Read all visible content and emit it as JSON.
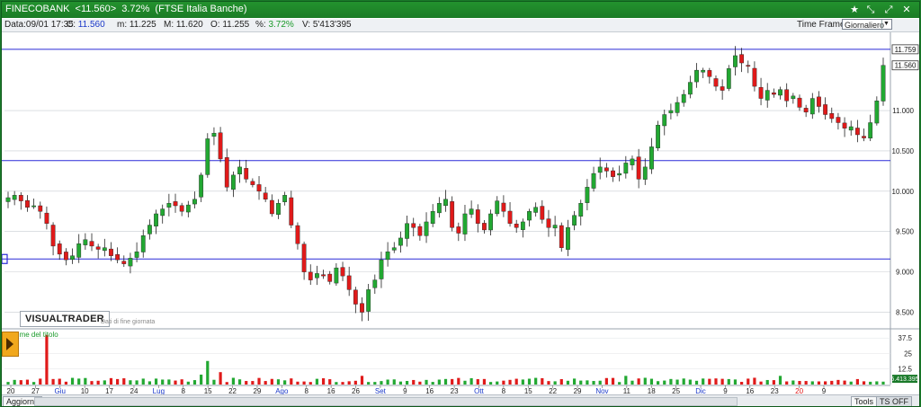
{
  "window": {
    "title_symbol": "FINECOBANK",
    "title_price": "<11.560>",
    "title_change": "3.72%",
    "title_index": "(FTSE Italia Banche)",
    "icons": [
      "star-icon",
      "shrink-icon",
      "expand-icon",
      "close-icon"
    ]
  },
  "infobar": {
    "data_label": "Data:",
    "data_value": "09/01 17:35",
    "c_label": "C:",
    "c_value": "11.560",
    "m_label": "m:",
    "m_value": "11.225",
    "M_label": "M:",
    "M_value": "11.620",
    "o_label": "O:",
    "o_value": "11.255",
    "pct_label": "%:",
    "pct_value": "3.72%",
    "v_label": "V:",
    "v_value": "5'413'395",
    "timeframe_label": "Time Frame",
    "timeframe_value": "Giornaliero"
  },
  "logo": {
    "text": "VISUALTRADER",
    "subtitle": "Dati di fine giornata"
  },
  "volume_label": "Volume del titolo",
  "bottombar": {
    "update_button": "Aggiorna",
    "tools_button": "Tools",
    "tsoff_button": "TS OFF"
  },
  "colors": {
    "up": "#22a832",
    "down": "#e01a1a",
    "hline": "#2a2ad8",
    "frame": "#1b7c26"
  },
  "chart_data": {
    "type": "candlestick",
    "price_axis": {
      "ticks": [
        8.5,
        9.0,
        9.5,
        10.0,
        10.5,
        11.0
      ],
      "ylim": [
        8.35,
        11.88
      ]
    },
    "price_labels": [
      {
        "value": 11.759,
        "label": "11.759"
      },
      {
        "value": 11.56,
        "label": "11.560"
      }
    ],
    "horizontal_lines": [
      11.759,
      10.38,
      9.16
    ],
    "volume_axis": {
      "ticks": [
        12.5,
        25,
        37.5
      ],
      "ylim": [
        0,
        42
      ],
      "last_label": "5.413.395"
    },
    "x_tick_labels": [
      {
        "label": "20",
        "month": false
      },
      {
        "label": "27",
        "month": false
      },
      {
        "label": "Giu",
        "month": true
      },
      {
        "label": "10",
        "month": false
      },
      {
        "label": "17",
        "month": false
      },
      {
        "label": "24",
        "month": false
      },
      {
        "label": "Lug",
        "month": true
      },
      {
        "label": "8",
        "month": false
      },
      {
        "label": "15",
        "month": false
      },
      {
        "label": "22",
        "month": false
      },
      {
        "label": "29",
        "month": false
      },
      {
        "label": "Ago",
        "month": true
      },
      {
        "label": "8",
        "month": false
      },
      {
        "label": "16",
        "month": false
      },
      {
        "label": "26",
        "month": false
      },
      {
        "label": "Set",
        "month": true
      },
      {
        "label": "9",
        "month": false
      },
      {
        "label": "16",
        "month": false
      },
      {
        "label": "23",
        "month": false
      },
      {
        "label": "Ott",
        "month": true
      },
      {
        "label": "8",
        "month": false
      },
      {
        "label": "15",
        "month": false
      },
      {
        "label": "22",
        "month": false
      },
      {
        "label": "29",
        "month": false
      },
      {
        "label": "Nov",
        "month": true
      },
      {
        "label": "11",
        "month": false
      },
      {
        "label": "18",
        "month": false
      },
      {
        "label": "25",
        "month": false
      },
      {
        "label": "Dic",
        "month": true
      },
      {
        "label": "9",
        "month": false
      },
      {
        "label": "16",
        "month": false
      },
      {
        "label": "23",
        "month": false
      },
      {
        "label": "20",
        "month": false,
        "highlight": true
      },
      {
        "label": "9",
        "month": false
      }
    ],
    "close": [
      9.92,
      9.95,
      9.88,
      9.8,
      9.82,
      9.75,
      9.6,
      9.32,
      9.22,
      9.15,
      9.2,
      9.35,
      9.4,
      9.32,
      9.28,
      9.3,
      9.2,
      9.15,
      9.1,
      9.17,
      9.25,
      9.45,
      9.58,
      9.72,
      9.78,
      9.85,
      9.82,
      9.75,
      9.83,
      9.9,
      10.2,
      10.65,
      10.72,
      10.4,
      10.05,
      10.2,
      10.3,
      10.15,
      10.08,
      10.0,
      9.9,
      9.72,
      9.85,
      9.95,
      9.58,
      9.35,
      9.0,
      8.9,
      8.98,
      8.95,
      8.88,
      9.05,
      8.95,
      8.78,
      8.6,
      8.5,
      8.78,
      8.9,
      9.15,
      9.25,
      9.3,
      9.42,
      9.6,
      9.55,
      9.45,
      9.62,
      9.75,
      9.85,
      9.9,
      9.55,
      9.48,
      9.72,
      9.78,
      9.6,
      9.52,
      9.72,
      9.88,
      9.75,
      9.6,
      9.55,
      9.62,
      9.75,
      9.8,
      9.65,
      9.55,
      9.58,
      9.3,
      9.55,
      9.7,
      9.85,
      10.05,
      10.22,
      10.3,
      10.25,
      10.18,
      10.22,
      10.35,
      10.4,
      10.15,
      10.3,
      10.55,
      10.82,
      10.95,
      11.0,
      11.1,
      11.2,
      11.35,
      11.5,
      11.5,
      11.42,
      11.3,
      11.25,
      11.52,
      11.68,
      11.59,
      11.55,
      11.3,
      11.15,
      11.25,
      11.2,
      11.26,
      11.12,
      11.18,
      11.04,
      10.98,
      11.15,
      11.05,
      10.95,
      10.9,
      10.85,
      10.78,
      10.8,
      10.7,
      10.66,
      10.85,
      11.12,
      11.56
    ]
  }
}
